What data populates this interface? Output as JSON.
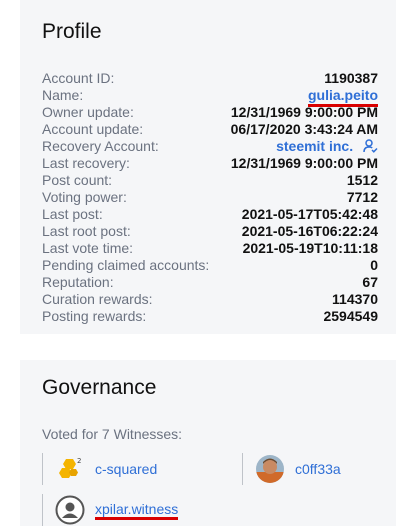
{
  "profile": {
    "title": "Profile",
    "rows": [
      {
        "label": "Account ID:",
        "value": "1190387"
      },
      {
        "label": "Name:",
        "value": "gulia.peito"
      },
      {
        "label": "Owner update:",
        "value": "12/31/1969 9:00:00 PM"
      },
      {
        "label": "Account update:",
        "value": "06/17/2020 3:43:24 AM"
      },
      {
        "label": "Recovery Account:",
        "value": "steemit inc."
      },
      {
        "label": "Last recovery:",
        "value": "12/31/1969 9:00:00 PM"
      },
      {
        "label": "Post count:",
        "value": "1512"
      },
      {
        "label": "Voting power:",
        "value": "7712"
      },
      {
        "label": "Last post:",
        "value": "2021-05-17T05:42:48"
      },
      {
        "label": "Last root post:",
        "value": "2021-05-16T06:22:24"
      },
      {
        "label": "Last vote time:",
        "value": "2021-05-19T10:11:18"
      },
      {
        "label": "Pending claimed accounts:",
        "value": "0"
      },
      {
        "label": "Reputation:",
        "value": "67"
      },
      {
        "label": "Curation rewards:",
        "value": "114370"
      },
      {
        "label": "Posting rewards:",
        "value": "2594549"
      }
    ]
  },
  "governance": {
    "title": "Governance",
    "voted_text": "Voted for 7 Witnesses:",
    "witnesses": [
      {
        "name": "c-squared",
        "icon": "c-squared-logo-icon"
      },
      {
        "name": "c0ff33a",
        "icon": "avatar-photo-icon"
      },
      {
        "name": "xpilar.witness",
        "icon": "default-avatar-icon"
      }
    ]
  },
  "colors": {
    "link": "#2f6fd6",
    "annotation_red": "#d90000",
    "card_bg": "#f5f6f8"
  }
}
